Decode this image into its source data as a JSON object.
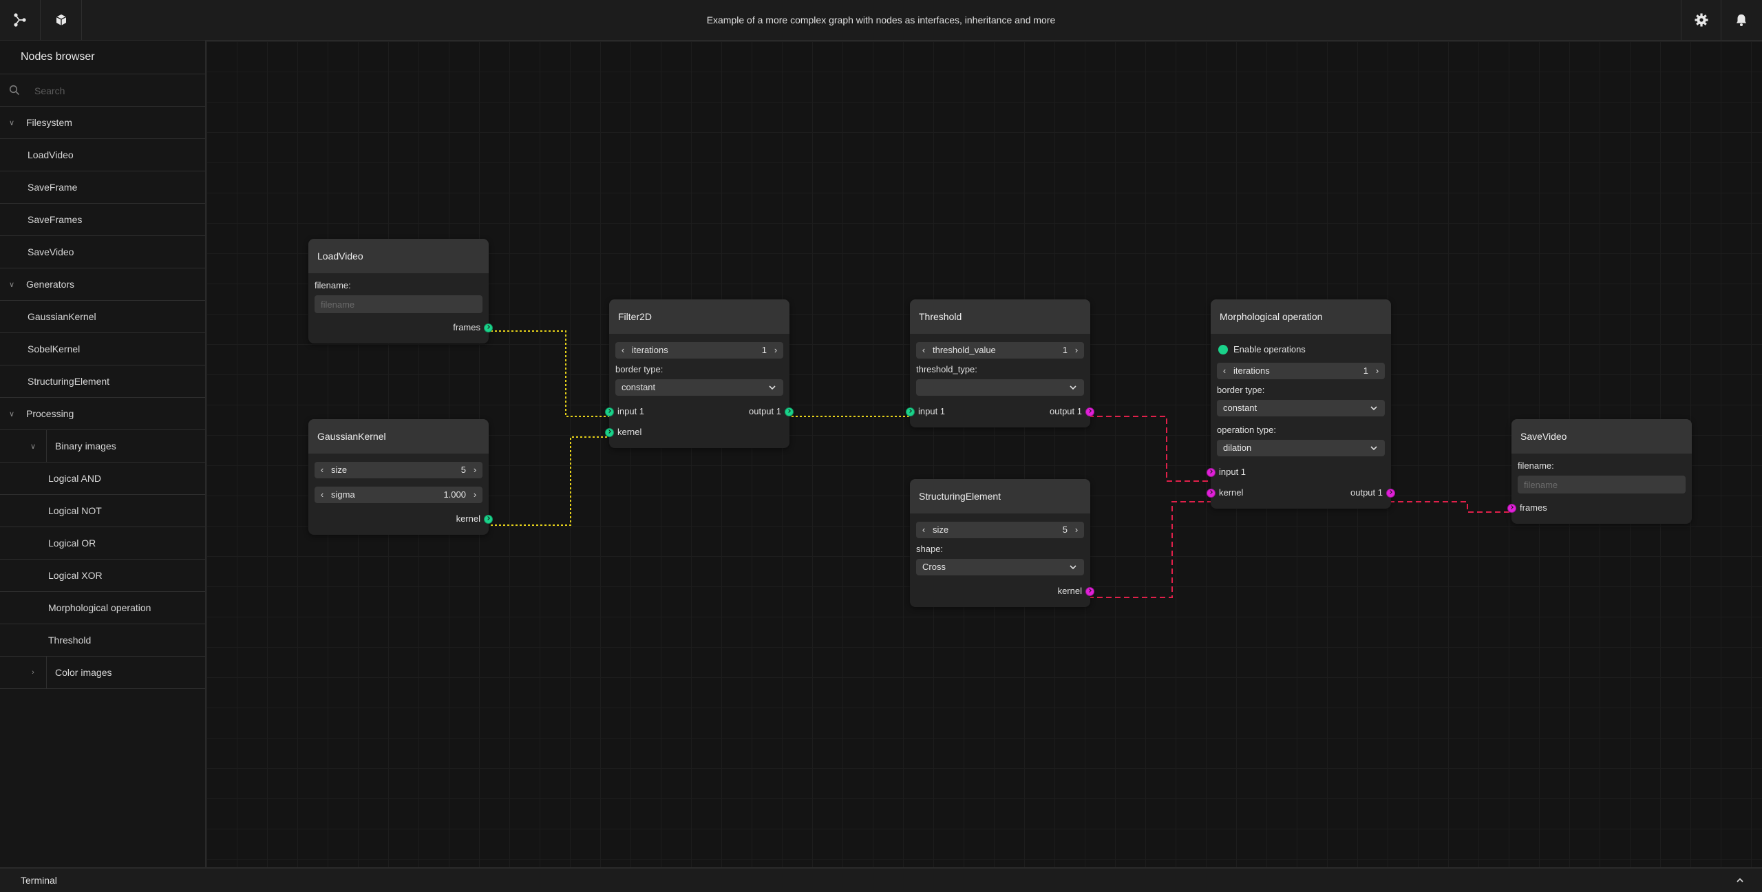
{
  "header": {
    "title": "Example of a more complex graph with nodes as interfaces, inheritance and more",
    "icons": [
      "graph-share-icon",
      "cube-icon",
      "gear-icon",
      "bell-icon"
    ]
  },
  "sidebar": {
    "title": "Nodes browser",
    "search_placeholder": "Search",
    "categories": [
      {
        "label": "Filesystem",
        "items": [
          "LoadVideo",
          "SaveFrame",
          "SaveFrames",
          "SaveVideo"
        ]
      },
      {
        "label": "Generators",
        "items": [
          "GaussianKernel",
          "SobelKernel",
          "StructuringElement"
        ]
      },
      {
        "label": "Processing",
        "subcategories": [
          {
            "label": "Binary images",
            "expanded": true,
            "items": [
              "Logical AND",
              "Logical NOT",
              "Logical OR",
              "Logical XOR",
              "Morphological operation",
              "Threshold"
            ]
          },
          {
            "label": "Color images",
            "expanded": false,
            "items": []
          }
        ]
      }
    ]
  },
  "nodes": {
    "loadvideo": {
      "title": "LoadVideo",
      "filename_label": "filename:",
      "filename_placeholder": "filename",
      "out_port": "frames"
    },
    "gaussian": {
      "title": "GaussianKernel",
      "size_name": "size",
      "size_value": "5",
      "sigma_name": "sigma",
      "sigma_value": "1.000",
      "out_port": "kernel"
    },
    "filter2d": {
      "title": "Filter2D",
      "iterations_name": "iterations",
      "iterations_value": "1",
      "border_label": "border type:",
      "border_value": "constant",
      "in_port1": "input 1",
      "in_port2": "kernel",
      "out_port": "output 1"
    },
    "threshold": {
      "title": "Threshold",
      "tv_name": "threshold_value",
      "tv_value": "1",
      "type_label": "threshold_type:",
      "type_value": "",
      "in_port": "input 1",
      "out_port": "output 1"
    },
    "structuring": {
      "title": "StructuringElement",
      "size_name": "size",
      "size_value": "5",
      "shape_label": "shape:",
      "shape_value": "Cross",
      "out_port": "kernel"
    },
    "morph": {
      "title": "Morphological operation",
      "enable_label": "Enable operations",
      "iterations_name": "iterations",
      "iterations_value": "1",
      "border_label": "border type:",
      "border_value": "constant",
      "op_label": "operation type:",
      "op_value": "dilation",
      "in_port1": "input 1",
      "in_port2": "kernel",
      "out_port": "output 1"
    },
    "savevideo": {
      "title": "SaveVideo",
      "filename_label": "filename:",
      "filename_placeholder": "filename",
      "in_port": "frames"
    }
  },
  "colors": {
    "port_green": "#1ad28a",
    "port_magenta": "#e020d8",
    "wire_yellow": "#e6d21a",
    "wire_red": "#e0204a"
  },
  "terminal": {
    "label": "Terminal"
  }
}
